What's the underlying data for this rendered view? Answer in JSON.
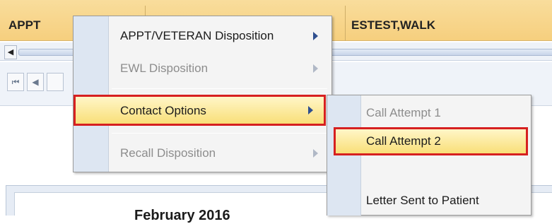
{
  "grid": {
    "col1_text": "APPT",
    "col3_text": "ESTEST,WALK"
  },
  "scrollbar": {
    "left_arrow": "◀"
  },
  "navigator": {
    "first": "⏮",
    "prev": "◀"
  },
  "calendar": {
    "month": "February 2016"
  },
  "context_menu": {
    "items": [
      {
        "label": "APPT/VETERAN Disposition",
        "enabled": true,
        "has_submenu": true
      },
      {
        "label": "EWL Disposition",
        "enabled": false,
        "has_submenu": true
      },
      {
        "label": "Contact Options",
        "enabled": true,
        "has_submenu": true,
        "highlighted": true
      },
      {
        "label": "Recall Disposition",
        "enabled": false,
        "has_submenu": true
      }
    ]
  },
  "submenu": {
    "items": [
      {
        "label": "Call Attempt 1",
        "enabled": false
      },
      {
        "label": "Call Attempt 2",
        "enabled": true,
        "highlighted": true
      },
      {
        "label": "Letter Sent to Patient",
        "enabled": true
      }
    ]
  },
  "colors": {
    "grid_header": "#f6cf7e",
    "highlight_border": "#d62020",
    "menu_gutter": "#dde6f2"
  }
}
